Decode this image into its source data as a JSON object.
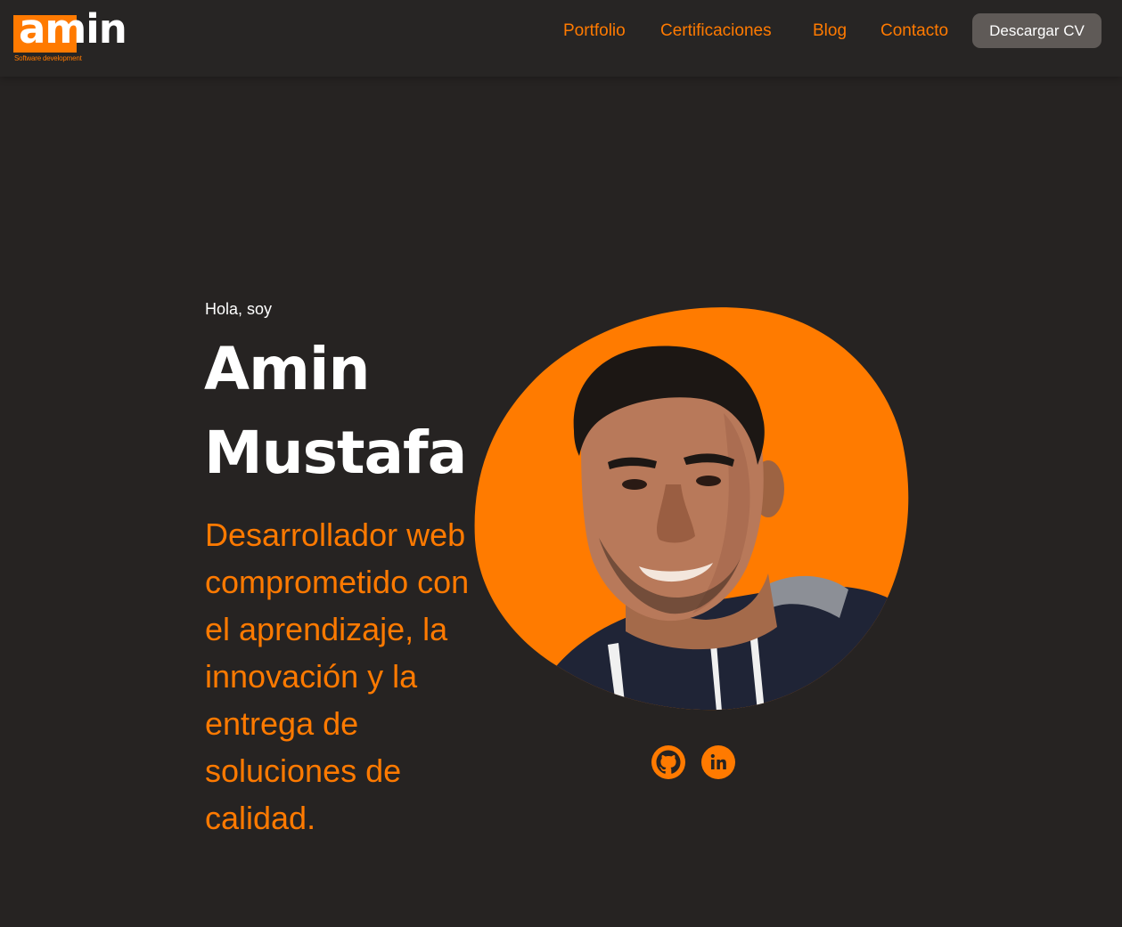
{
  "brand": {
    "logo_text_a": "am",
    "logo_text_b": "in",
    "tagline": "Software development",
    "accent_color": "#ff7a00"
  },
  "nav": {
    "items": [
      {
        "label": "Portfolio"
      },
      {
        "label": "Certificaciones"
      },
      {
        "label": "Blog"
      },
      {
        "label": "Contacto"
      }
    ],
    "cv_button": "Descargar CV"
  },
  "hero": {
    "greeting": "Hola, soy",
    "name_first": "Amin",
    "name_last": "Mustafa",
    "tagline": "Desarrollador web comprometido con el aprendizaje, la innovación y la entrega de soluciones de calidad."
  },
  "socials": [
    {
      "icon": "github-icon"
    },
    {
      "icon": "linkedin-icon"
    }
  ]
}
